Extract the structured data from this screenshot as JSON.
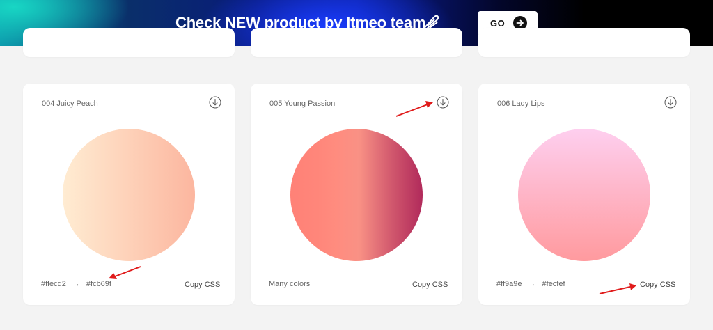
{
  "banner": {
    "title": "Check NEW product by Itmeo team",
    "go_label": "GO",
    "icon": "feather-icon",
    "arrow_icon": "arrow-right-circle-icon"
  },
  "gradients": [
    {
      "title": "004 Juicy Peach",
      "code_from": "#ffecd2",
      "code_to": "#fcb69f",
      "arrow": "→",
      "copy_label": "Copy CSS"
    },
    {
      "title": "005 Young Passion",
      "many_colors": "Many colors",
      "copy_label": "Copy CSS"
    },
    {
      "title": "006 Lady Lips",
      "code_from": "#ff9a9e",
      "code_to": "#fecfef",
      "arrow": "→",
      "copy_label": "Copy CSS"
    }
  ],
  "colors": {
    "annotation_arrow": "#e01b1b"
  }
}
